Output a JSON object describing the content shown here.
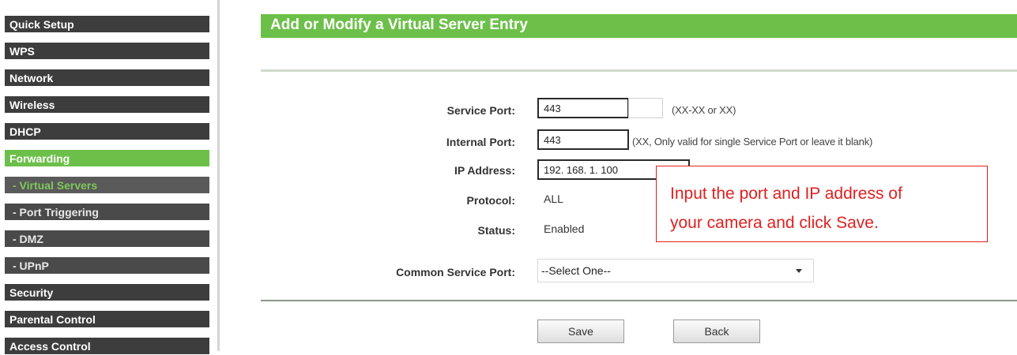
{
  "sidebar": {
    "items": [
      {
        "label": "Quick Setup"
      },
      {
        "label": "WPS"
      },
      {
        "label": "Network"
      },
      {
        "label": "Wireless"
      },
      {
        "label": "DHCP"
      },
      {
        "label": "Forwarding"
      },
      {
        "label": "- Virtual Servers"
      },
      {
        "label": "- Port Triggering"
      },
      {
        "label": "- DMZ"
      },
      {
        "label": "- UPnP"
      },
      {
        "label": "Security"
      },
      {
        "label": "Parental Control"
      },
      {
        "label": "Access Control"
      }
    ]
  },
  "page": {
    "title": "Add or Modify a Virtual Server Entry"
  },
  "form": {
    "service_port": {
      "label": "Service Port:",
      "value": "443",
      "hint": "(XX-XX or XX)"
    },
    "internal_port": {
      "label": "Internal Port:",
      "value": "443",
      "hint": "(XX, Only valid for single Service Port or leave it blank)"
    },
    "ip_address": {
      "label": "IP Address:",
      "value": "192. 168. 1. 100"
    },
    "protocol": {
      "label": "Protocol:",
      "value": "ALL"
    },
    "status": {
      "label": "Status:",
      "value": "Enabled"
    },
    "common_service_port": {
      "label": "Common Service Port:",
      "value": "--Select One--"
    }
  },
  "callout": {
    "line1": "Input the port and IP address of",
    "line2": "your camera and click Save."
  },
  "buttons": {
    "save": "Save",
    "back": "Back"
  },
  "colors": {
    "accent": "#6cc04a",
    "sidebar_bg": "#3d3d3d",
    "callout": "#e02020"
  }
}
